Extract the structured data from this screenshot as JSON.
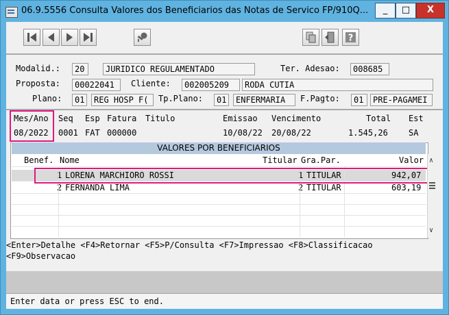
{
  "window": {
    "title": "06.9.5556  Consulta  Valores dos Beneficiarios das Notas de Servico FP/910Q...",
    "min_glyph": "_",
    "max_glyph": "□",
    "close_glyph": "X"
  },
  "toolbar": {
    "icons": [
      "first-record-icon",
      "previous-record-icon",
      "next-record-icon",
      "last-record-icon",
      "key-icon",
      "copy-icon",
      "exit-door-icon",
      "help-icon"
    ]
  },
  "header": {
    "modalid_label": "Modalid.:",
    "modalid_code": "20",
    "modalid_desc": "JURIDICO REGULAMENTADO",
    "ter_adesao_label": "Ter. Adesao:",
    "ter_adesao_value": "008685",
    "proposta_label": "Proposta:",
    "proposta_value": "00022041",
    "cliente_label": "Cliente:",
    "cliente_code": "002005209",
    "cliente_name": "RODA CUTIA",
    "plano_label": "Plano:",
    "plano_code": "01",
    "plano_desc": "REG HOSP F(",
    "tp_plano_label": "Tp.Plano:",
    "tp_plano_code": "01",
    "tp_plano_desc": "ENFERMARIA",
    "f_pagto_label": "F.Pagto:",
    "f_pagto_code": "01",
    "f_pagto_desc": "PRE-PAGAMEI"
  },
  "invoice": {
    "headers": {
      "mes_ano": "Mes/Ano",
      "seq": "Seq",
      "esp": "Esp",
      "fatura": "Fatura",
      "titulo": "Titulo",
      "emissao": "Emissao",
      "vencimento": "Vencimento",
      "total": "Total",
      "est": "Est"
    },
    "row": {
      "mes_ano": "08/2022",
      "seq": "0001",
      "esp": "FAT",
      "fatura": "000000",
      "titulo": "",
      "emissao": "10/08/22",
      "vencimento": "20/08/22",
      "total": "1.545,26",
      "est": "SA"
    }
  },
  "grid": {
    "title": "VALORES POR BENEFICIARIOS",
    "headers": {
      "benef": "Benef.",
      "nome": "Nome",
      "titular": "Titular",
      "grau": "Gra.Par.",
      "valor": "Valor"
    },
    "rows": [
      {
        "benef": "1",
        "nome": "LORENA MARCHIORO ROSSI",
        "titular": "1",
        "grau": "TITULAR",
        "valor": "942,07"
      },
      {
        "benef": "2",
        "nome": "FERNANDA LIMA",
        "titular": "2",
        "grau": "TITULAR",
        "valor": "603,19"
      }
    ]
  },
  "keys": {
    "line1": "<Enter>Detalhe <F4>Retornar <F5>P/Consulta <F7>Impressao <F8>Classificacao",
    "line2": "<F9>Observacao"
  },
  "status": {
    "text": "Enter data or press ESC to end."
  },
  "colors": {
    "title_bar": "#60b3e0",
    "highlight": "#e0177d",
    "grid_header": "#b5c9de",
    "close_button": "#c7332b"
  }
}
